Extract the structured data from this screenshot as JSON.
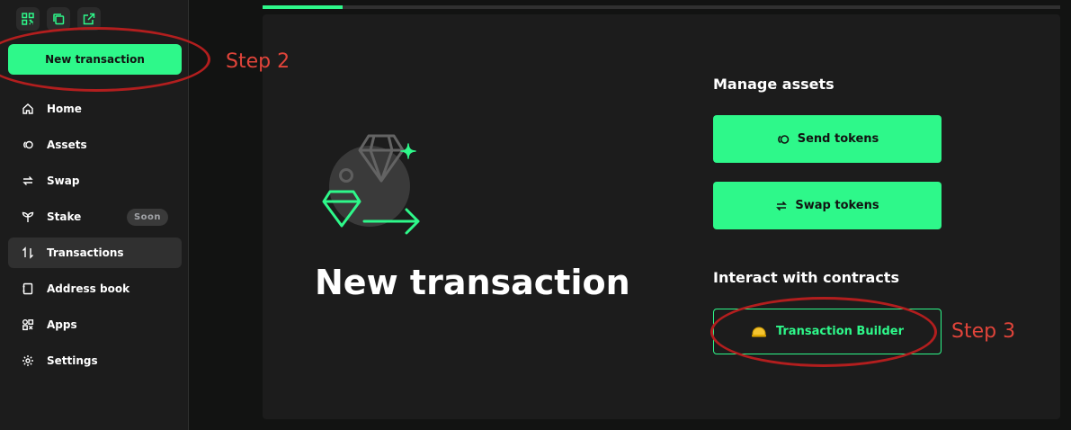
{
  "colors": {
    "accent": "#2ef88a",
    "background": "#121312",
    "panel": "#1c1c1c",
    "annotation": "#e0443a"
  },
  "topbar": {
    "icons": [
      "qr-code-icon",
      "copy-icon",
      "external-link-icon"
    ]
  },
  "sidebar": {
    "new_transaction_label": "New transaction",
    "items": [
      {
        "label": "Home",
        "icon": "home-icon"
      },
      {
        "label": "Assets",
        "icon": "assets-icon"
      },
      {
        "label": "Swap",
        "icon": "swap-icon"
      },
      {
        "label": "Stake",
        "icon": "sprout-icon",
        "badge": "Soon"
      },
      {
        "label": "Transactions",
        "icon": "transactions-icon",
        "active": true
      },
      {
        "label": "Address book",
        "icon": "address-book-icon"
      },
      {
        "label": "Apps",
        "icon": "apps-icon"
      },
      {
        "label": "Settings",
        "icon": "gear-icon"
      }
    ]
  },
  "progress": {
    "fraction": 0.1
  },
  "main": {
    "title": "New transaction",
    "manage_assets": {
      "heading": "Manage assets",
      "send_label": "Send tokens",
      "swap_label": "Swap tokens"
    },
    "contracts": {
      "heading": "Interact with contracts",
      "builder_label": "Transaction Builder"
    }
  },
  "annotations": {
    "step2": "Step 2",
    "step3": "Step 3"
  }
}
